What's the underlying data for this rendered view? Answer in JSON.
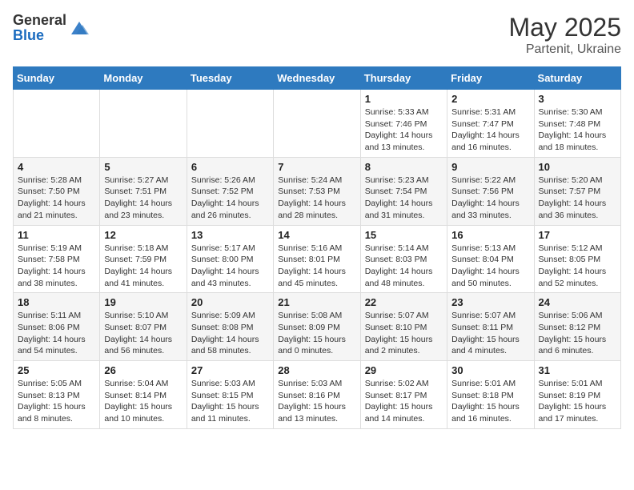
{
  "header": {
    "logo_general": "General",
    "logo_blue": "Blue",
    "title": "May 2025",
    "subtitle": "Partenit, Ukraine"
  },
  "weekdays": [
    "Sunday",
    "Monday",
    "Tuesday",
    "Wednesday",
    "Thursday",
    "Friday",
    "Saturday"
  ],
  "weeks": [
    [
      {
        "day": "",
        "info": ""
      },
      {
        "day": "",
        "info": ""
      },
      {
        "day": "",
        "info": ""
      },
      {
        "day": "",
        "info": ""
      },
      {
        "day": "1",
        "info": "Sunrise: 5:33 AM\nSunset: 7:46 PM\nDaylight: 14 hours\nand 13 minutes."
      },
      {
        "day": "2",
        "info": "Sunrise: 5:31 AM\nSunset: 7:47 PM\nDaylight: 14 hours\nand 16 minutes."
      },
      {
        "day": "3",
        "info": "Sunrise: 5:30 AM\nSunset: 7:48 PM\nDaylight: 14 hours\nand 18 minutes."
      }
    ],
    [
      {
        "day": "4",
        "info": "Sunrise: 5:28 AM\nSunset: 7:50 PM\nDaylight: 14 hours\nand 21 minutes."
      },
      {
        "day": "5",
        "info": "Sunrise: 5:27 AM\nSunset: 7:51 PM\nDaylight: 14 hours\nand 23 minutes."
      },
      {
        "day": "6",
        "info": "Sunrise: 5:26 AM\nSunset: 7:52 PM\nDaylight: 14 hours\nand 26 minutes."
      },
      {
        "day": "7",
        "info": "Sunrise: 5:24 AM\nSunset: 7:53 PM\nDaylight: 14 hours\nand 28 minutes."
      },
      {
        "day": "8",
        "info": "Sunrise: 5:23 AM\nSunset: 7:54 PM\nDaylight: 14 hours\nand 31 minutes."
      },
      {
        "day": "9",
        "info": "Sunrise: 5:22 AM\nSunset: 7:56 PM\nDaylight: 14 hours\nand 33 minutes."
      },
      {
        "day": "10",
        "info": "Sunrise: 5:20 AM\nSunset: 7:57 PM\nDaylight: 14 hours\nand 36 minutes."
      }
    ],
    [
      {
        "day": "11",
        "info": "Sunrise: 5:19 AM\nSunset: 7:58 PM\nDaylight: 14 hours\nand 38 minutes."
      },
      {
        "day": "12",
        "info": "Sunrise: 5:18 AM\nSunset: 7:59 PM\nDaylight: 14 hours\nand 41 minutes."
      },
      {
        "day": "13",
        "info": "Sunrise: 5:17 AM\nSunset: 8:00 PM\nDaylight: 14 hours\nand 43 minutes."
      },
      {
        "day": "14",
        "info": "Sunrise: 5:16 AM\nSunset: 8:01 PM\nDaylight: 14 hours\nand 45 minutes."
      },
      {
        "day": "15",
        "info": "Sunrise: 5:14 AM\nSunset: 8:03 PM\nDaylight: 14 hours\nand 48 minutes."
      },
      {
        "day": "16",
        "info": "Sunrise: 5:13 AM\nSunset: 8:04 PM\nDaylight: 14 hours\nand 50 minutes."
      },
      {
        "day": "17",
        "info": "Sunrise: 5:12 AM\nSunset: 8:05 PM\nDaylight: 14 hours\nand 52 minutes."
      }
    ],
    [
      {
        "day": "18",
        "info": "Sunrise: 5:11 AM\nSunset: 8:06 PM\nDaylight: 14 hours\nand 54 minutes."
      },
      {
        "day": "19",
        "info": "Sunrise: 5:10 AM\nSunset: 8:07 PM\nDaylight: 14 hours\nand 56 minutes."
      },
      {
        "day": "20",
        "info": "Sunrise: 5:09 AM\nSunset: 8:08 PM\nDaylight: 14 hours\nand 58 minutes."
      },
      {
        "day": "21",
        "info": "Sunrise: 5:08 AM\nSunset: 8:09 PM\nDaylight: 15 hours\nand 0 minutes."
      },
      {
        "day": "22",
        "info": "Sunrise: 5:07 AM\nSunset: 8:10 PM\nDaylight: 15 hours\nand 2 minutes."
      },
      {
        "day": "23",
        "info": "Sunrise: 5:07 AM\nSunset: 8:11 PM\nDaylight: 15 hours\nand 4 minutes."
      },
      {
        "day": "24",
        "info": "Sunrise: 5:06 AM\nSunset: 8:12 PM\nDaylight: 15 hours\nand 6 minutes."
      }
    ],
    [
      {
        "day": "25",
        "info": "Sunrise: 5:05 AM\nSunset: 8:13 PM\nDaylight: 15 hours\nand 8 minutes."
      },
      {
        "day": "26",
        "info": "Sunrise: 5:04 AM\nSunset: 8:14 PM\nDaylight: 15 hours\nand 10 minutes."
      },
      {
        "day": "27",
        "info": "Sunrise: 5:03 AM\nSunset: 8:15 PM\nDaylight: 15 hours\nand 11 minutes."
      },
      {
        "day": "28",
        "info": "Sunrise: 5:03 AM\nSunset: 8:16 PM\nDaylight: 15 hours\nand 13 minutes."
      },
      {
        "day": "29",
        "info": "Sunrise: 5:02 AM\nSunset: 8:17 PM\nDaylight: 15 hours\nand 14 minutes."
      },
      {
        "day": "30",
        "info": "Sunrise: 5:01 AM\nSunset: 8:18 PM\nDaylight: 15 hours\nand 16 minutes."
      },
      {
        "day": "31",
        "info": "Sunrise: 5:01 AM\nSunset: 8:19 PM\nDaylight: 15 hours\nand 17 minutes."
      }
    ]
  ]
}
